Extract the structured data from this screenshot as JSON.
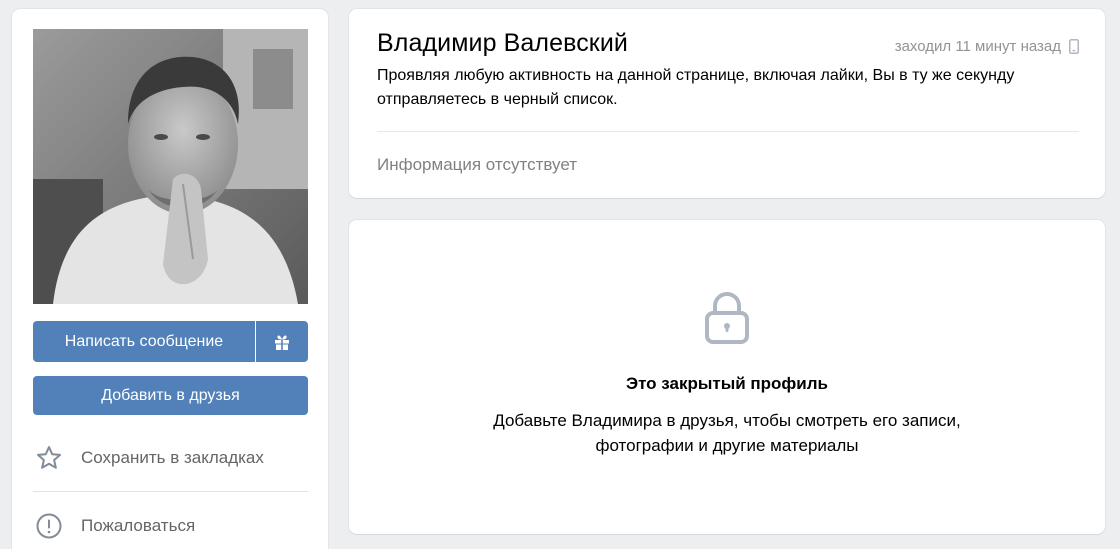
{
  "profile": {
    "name": "Владимир Валевский",
    "last_seen": "заходил 11 минут назад",
    "device_icon": "phone-icon",
    "status": "Проявляя любую активность на данной странице, включая лайки, Вы в ту же секунду отправляетесь в черный список.",
    "no_info": "Информация отсутствует"
  },
  "actions": {
    "message_label": "Написать сообщение",
    "gift_icon": "gift-icon",
    "add_friend_label": "Добавить в друзья",
    "bookmark_label": "Сохранить в закладках",
    "bookmark_icon": "star-icon",
    "report_label": "Пожаловаться",
    "report_icon": "exclamation-icon"
  },
  "closed": {
    "icon": "lock-icon",
    "title": "Это закрытый профиль",
    "text": "Добавьте Владимира в друзья, чтобы смотреть его записи, фотографии и другие материалы"
  },
  "colors": {
    "accent": "#5181b8",
    "background": "#edeef0",
    "muted_text": "#818181"
  }
}
